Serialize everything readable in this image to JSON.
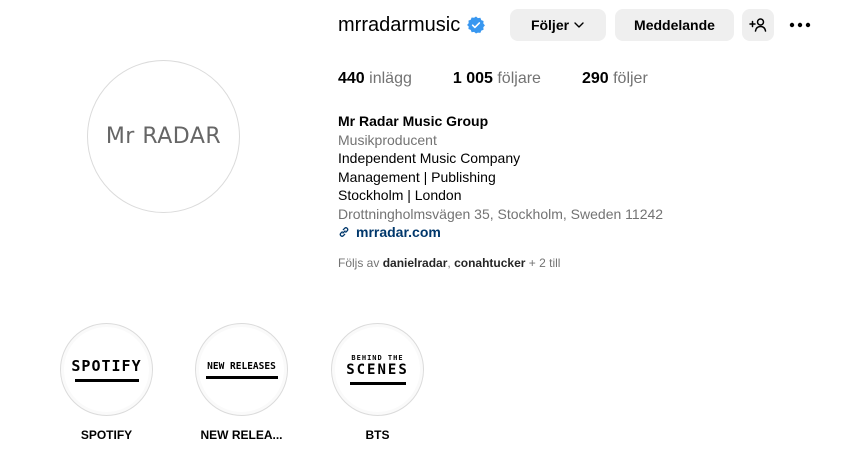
{
  "profile": {
    "avatar_text": "Mr RADAR",
    "username": "mrradarmusic",
    "verified_icon": "verified-badge-icon",
    "buttons": {
      "follow_label": "Följer",
      "message_label": "Meddelande",
      "adduser_label": "+♀"
    },
    "stats": {
      "posts_value": "440",
      "posts_label": "inlägg",
      "followers_value": "1 005",
      "followers_label": "följare",
      "following_value": "290",
      "following_label": "följer"
    },
    "bio": {
      "name": "Mr Radar Music Group",
      "category": "Musikproducent",
      "line1": "Independent Music Company",
      "line2": "Management | Publishing",
      "line3": "Stockholm | London",
      "address": "Drottningholmsvägen 35, Stockholm, Sweden 11242",
      "link": "mrradar.com"
    },
    "followed_by": {
      "prefix": "Följs av",
      "user1": "danielradar",
      "separator": ",",
      "user2": "conahtucker",
      "suffix": "+ 2 till"
    }
  },
  "highlights": [
    {
      "label": "SPOTIFY",
      "logo_text": "SPOTIFY"
    },
    {
      "label": "NEW RELEA...",
      "logo_text": "NEW RELEASES"
    },
    {
      "label": "BTS",
      "logo_top": "BEHIND THE",
      "logo_main": "SCENES"
    }
  ],
  "colors": {
    "verified_blue": "#3897f0",
    "link_blue": "#00376b",
    "muted_gray": "#737373",
    "button_bg": "#efefef"
  }
}
